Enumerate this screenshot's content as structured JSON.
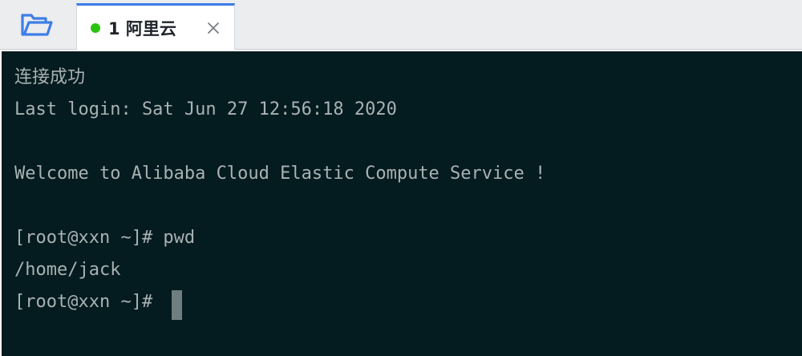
{
  "colors": {
    "tab_accent": "#3b7be8",
    "status_connected": "#2ac40f",
    "folder_icon": "#3e7fe6",
    "terminal_background": "#041b20",
    "terminal_text": "#a9b2b3",
    "cursor": "#6f7f80"
  },
  "toolbar": {
    "open_icon": "folder-open-icon"
  },
  "tabs": [
    {
      "number": "1",
      "name": "阿里云",
      "label": "1  阿里云",
      "status": "connected",
      "status_icon": "status-dot-icon",
      "close_icon": "close-icon"
    }
  ],
  "terminal": {
    "lines": [
      "连接成功",
      "Last login: Sat Jun 27 12:56:18 2020",
      "",
      "Welcome to Alibaba Cloud Elastic Compute Service !",
      "",
      "[root@xxn ~]# pwd",
      "/home/jack",
      "[root@xxn ~]# "
    ],
    "cursor_visible": true
  }
}
